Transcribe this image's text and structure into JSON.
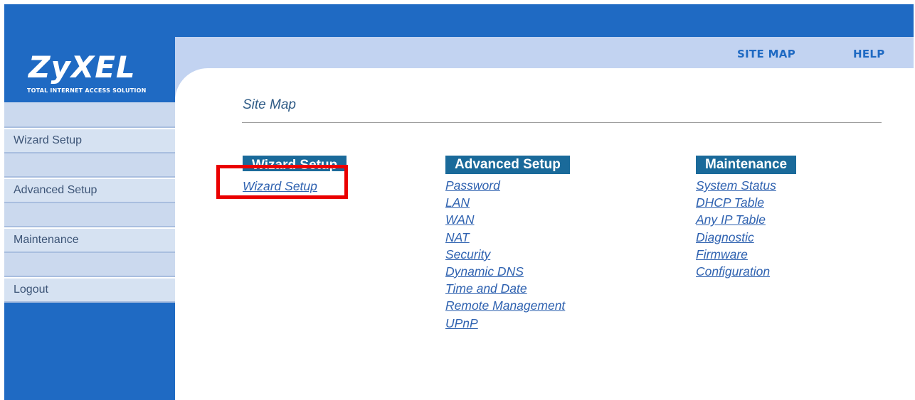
{
  "brand": {
    "logo": "ZyXEL",
    "tagline": "Total Internet Access Solution"
  },
  "header": {
    "site_map": "SITE MAP",
    "help": "HELP"
  },
  "sidebar": {
    "items": [
      {
        "label": "Wizard Setup"
      },
      {
        "label": "Advanced Setup"
      },
      {
        "label": "Maintenance"
      },
      {
        "label": "Logout"
      }
    ]
  },
  "main": {
    "title": "Site Map",
    "columns": [
      {
        "header": "Wizard Setup",
        "links": [
          "Wizard Setup"
        ]
      },
      {
        "header": "Advanced Setup",
        "links": [
          "Password",
          "LAN",
          "WAN",
          "NAT",
          "Security",
          "Dynamic DNS",
          "Time and Date",
          "Remote Management",
          "UPnP"
        ]
      },
      {
        "header": "Maintenance",
        "links": [
          "System Status",
          "DHCP Table",
          "Any IP Table",
          "Diagnostic",
          "Firmware",
          "Configuration"
        ]
      }
    ]
  },
  "colors": {
    "brand_blue": "#1f6ac3",
    "header_bg": "#c2d3f1",
    "link": "#2f62b0",
    "highlight": "#ea0000"
  }
}
